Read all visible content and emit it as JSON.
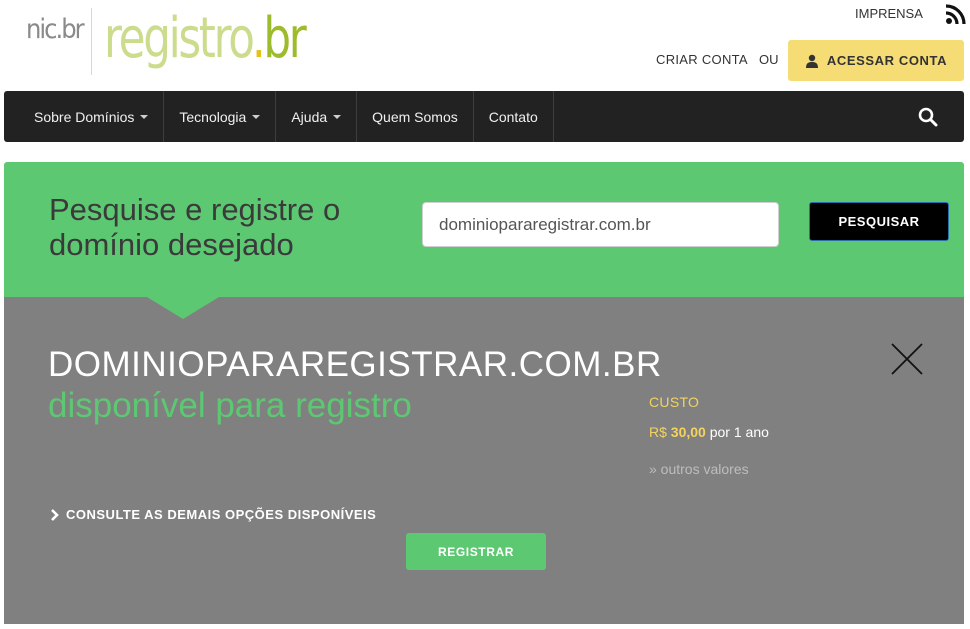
{
  "header": {
    "logo_nic": "nic.br",
    "logo_registro": "registro",
    "logo_br": "br",
    "imprensa": "IMPRENSA",
    "rss_icon": "rss-icon",
    "criar_conta": "CRIAR CONTA",
    "ou": "OU",
    "acessar_conta": "ACESSAR CONTA"
  },
  "nav": {
    "items": [
      {
        "label": "Sobre Domínios",
        "dropdown": true
      },
      {
        "label": "Tecnologia",
        "dropdown": true
      },
      {
        "label": "Ajuda",
        "dropdown": true
      },
      {
        "label": "Quem Somos",
        "dropdown": false
      },
      {
        "label": "Contato",
        "dropdown": false
      }
    ],
    "search_icon": "search-icon"
  },
  "search": {
    "headline": "Pesquise e registre o domínio desejado",
    "value": "dominiopararegistrar.com.br",
    "button": "PESQUISAR"
  },
  "result": {
    "domain": "DOMINIOPARAREGISTRAR.COM.BR",
    "status": "disponível para registro",
    "custo_label": "CUSTO",
    "currency": "R$",
    "amount": "30,00",
    "period": "por 1 ano",
    "outros": "» outros valores",
    "consulte": "CONSULTE AS DEMAIS OPÇÕES DISPONÍVEIS",
    "registrar": "REGISTRAR"
  },
  "colors": {
    "green": "#5dc872",
    "yellow_button": "#f6dc74",
    "navbar": "#222222",
    "result_panel": "#808080",
    "price_yellow": "#f3d35f"
  }
}
